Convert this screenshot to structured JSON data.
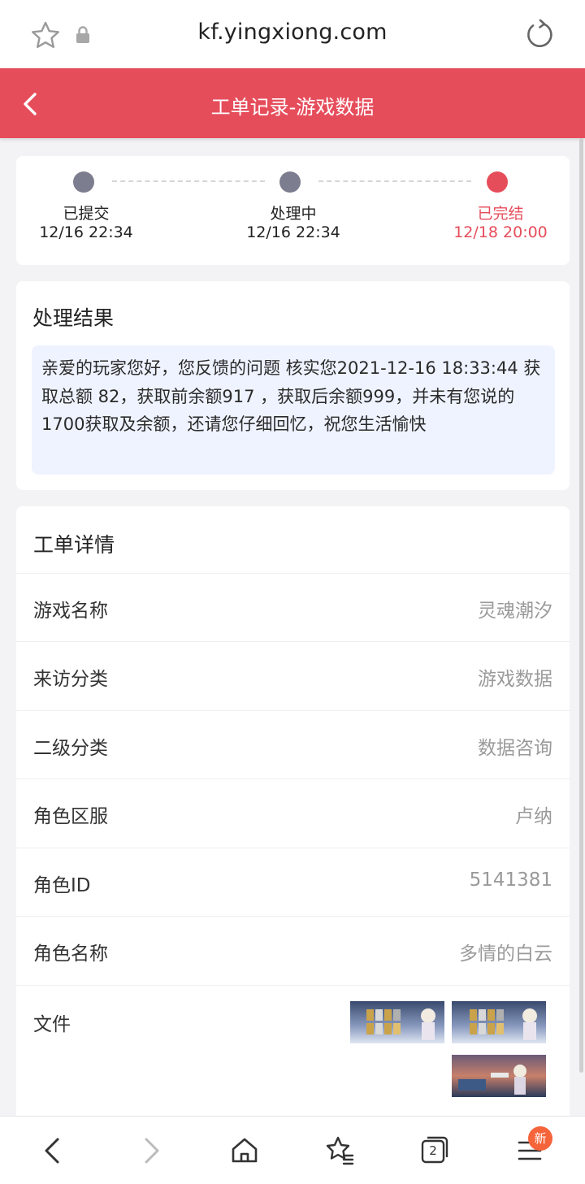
{
  "browser": {
    "url": "kf.yingxiong.com",
    "tab_count": "2",
    "menu_badge": "新"
  },
  "header": {
    "title": "工单记录-游戏数据"
  },
  "progress": {
    "steps": [
      {
        "label": "已提交",
        "time": "12/16 22:34",
        "state": "done"
      },
      {
        "label": "处理中",
        "time": "12/16 22:34",
        "state": "done"
      },
      {
        "label": "已完结",
        "time": "12/18 20:00",
        "state": "current"
      }
    ]
  },
  "result": {
    "title": "处理结果",
    "text": "亲爱的玩家您好，您反馈的问题 核实您2021-12-16 18:33:44 获取总额 82，获取前余额917 ，获取后余额999，并未有您说的1700获取及余额，还请您仔细回忆，祝您生活愉快"
  },
  "details": {
    "title": "工单详情",
    "rows": [
      {
        "label": "游戏名称",
        "value": "灵魂潮汐"
      },
      {
        "label": "来访分类",
        "value": "游戏数据"
      },
      {
        "label": "二级分类",
        "value": "数据咨询"
      },
      {
        "label": "角色区服",
        "value": "卢纳"
      },
      {
        "label": "角色ID",
        "value": "5141381"
      },
      {
        "label": "角色名称",
        "value": "多情的白云"
      }
    ],
    "files_label": "文件"
  },
  "colors": {
    "accent": "#e64d5b",
    "step_done": "#7c7d8e",
    "result_bg": "#eef3ff",
    "badge": "#f5643a"
  }
}
